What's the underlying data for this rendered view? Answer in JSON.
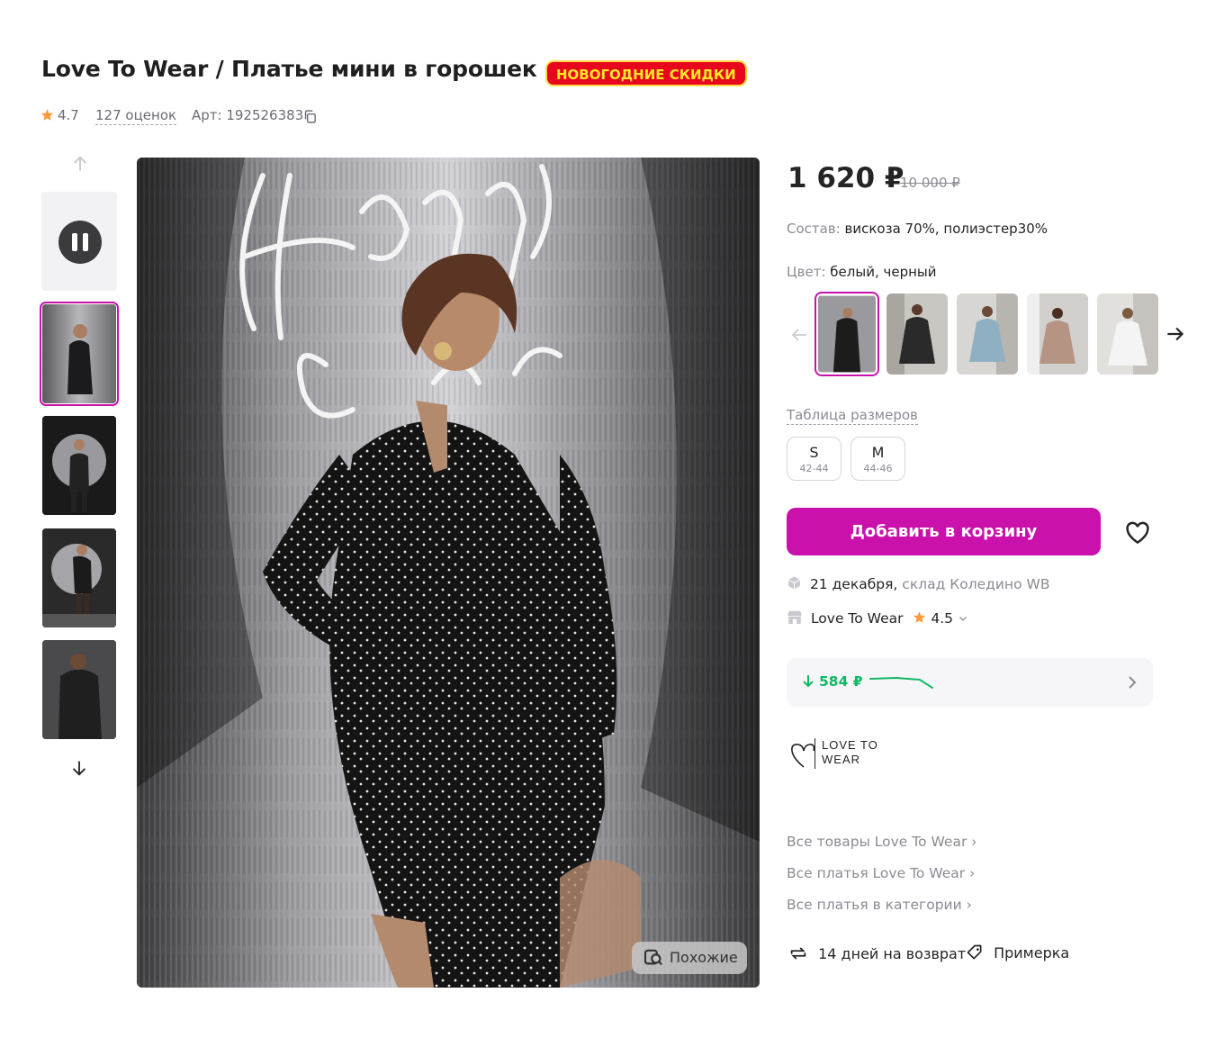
{
  "product": {
    "title": "Love To Wear / Платье мини в горошек",
    "badge": "НОВОГОДНИЕ СКИДКИ",
    "rating": "4.7",
    "reviews": "127 оценок",
    "article": "Арт: 192526383"
  },
  "gallery": {
    "similar_label": "Похожие"
  },
  "price": {
    "current": "1 620 ₽",
    "old": "10 000 ₽"
  },
  "composition": {
    "label": "Состав:",
    "value": "вискоза 70%, полиэстер30%"
  },
  "color": {
    "label": "Цвет:",
    "value": "белый, черный"
  },
  "sizes": {
    "table_link": "Таблица размеров",
    "items": [
      {
        "size": "S",
        "ru": "42-44"
      },
      {
        "size": "M",
        "ru": "44-46"
      }
    ]
  },
  "cart": {
    "button_label": "Добавить в корзину"
  },
  "delivery": {
    "date": "21 декабря,",
    "warehouse": "склад Коледино WB"
  },
  "seller": {
    "name": "Love To Wear",
    "rating": "4.5"
  },
  "price_history": {
    "value": "584 ₽"
  },
  "brand": {
    "logo_line1": "LOVE TO",
    "logo_line2": "WEAR"
  },
  "links": [
    "Все товары Love To Wear",
    "Все платья Love To Wear",
    "Все платья в категории"
  ],
  "footer": {
    "returns": "14 дней на возврат",
    "fitting": "Примерка"
  },
  "colors": {
    "accent": "#cb11ab",
    "badge_bg": "#e8061c",
    "badge_text": "#ffe72c",
    "trend_green": "#12b864",
    "star": "#ff9a3c"
  }
}
